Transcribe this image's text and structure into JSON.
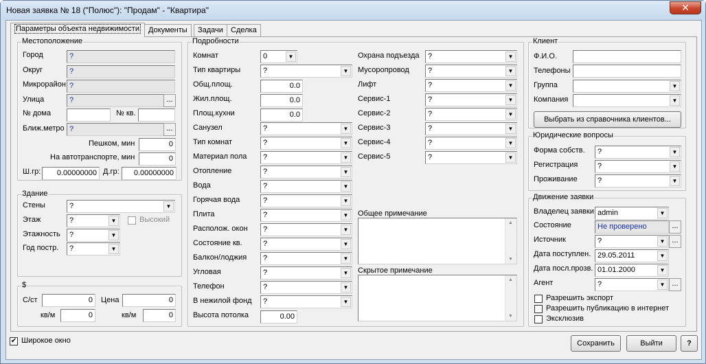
{
  "window": {
    "title": "Новая заявка № 18 (\"Полюс\"): \"Продам\" - \"Квартира\"",
    "close_glyph": "✕"
  },
  "tabs": [
    {
      "label": "Параметры объекта недвижимости"
    },
    {
      "label": "Документы"
    },
    {
      "label": "Задачи"
    },
    {
      "label": "Сделка"
    }
  ],
  "location": {
    "title": "Местоположение",
    "city": {
      "label": "Город",
      "value": "?"
    },
    "district": {
      "label": "Округ",
      "value": "?"
    },
    "microdistrict": {
      "label": "Микрорайон",
      "value": "?"
    },
    "street": {
      "label": "Улица",
      "value": "?"
    },
    "house": {
      "label": "№ дома",
      "value": ""
    },
    "apt": {
      "label": "№ кв.",
      "value": ""
    },
    "metro": {
      "label": "Ближ.метро",
      "value": "?"
    },
    "walk": {
      "label": "Пешком, мин",
      "value": "0"
    },
    "transport": {
      "label": "На автотранспорте, мин",
      "value": "0"
    },
    "lat": {
      "label": "Ш.гр:",
      "value": "0.00000000"
    },
    "lon": {
      "label": "Д.гр:",
      "value": "0.00000000"
    }
  },
  "building": {
    "title": "Здание",
    "walls": {
      "label": "Стены",
      "value": "?"
    },
    "floor": {
      "label": "Этаж",
      "value": "?"
    },
    "floors": {
      "label": "Этажность",
      "value": "?"
    },
    "year": {
      "label": "Год постр.",
      "value": "?"
    },
    "high": {
      "label": "Высокий",
      "checked": false
    }
  },
  "price": {
    "title": "$",
    "cost": {
      "label": "С/ст",
      "value": "0"
    },
    "price": {
      "label": "Цена",
      "value": "0"
    },
    "sqm1": {
      "label": "кв/м",
      "value": "0"
    },
    "sqm2": {
      "label": "кв/м",
      "value": "0"
    }
  },
  "details": {
    "title": "Подробности",
    "rooms": {
      "label": "Комнат",
      "value": "0"
    },
    "apt_type": {
      "label": "Тип квартиры",
      "value": "?"
    },
    "total_area": {
      "label": "Общ.площ.",
      "value": "0.0"
    },
    "living_area": {
      "label": "Жил.площ.",
      "value": "0.0"
    },
    "kitchen_area": {
      "label": "Площ.кухни",
      "value": "0.0"
    },
    "combo_rows": [
      {
        "label": "Санузел",
        "value": "?"
      },
      {
        "label": "Тип комнат",
        "value": "?"
      },
      {
        "label": "Материал пола",
        "value": "?"
      },
      {
        "label": "Отопление",
        "value": "?"
      },
      {
        "label": "Вода",
        "value": "?"
      },
      {
        "label": "Горячая вода",
        "value": "?"
      },
      {
        "label": "Плита",
        "value": "?"
      },
      {
        "label": "Располож. окон",
        "value": "?"
      },
      {
        "label": "Состояние кв.",
        "value": "?"
      },
      {
        "label": "Балкон/лоджия",
        "value": "?"
      },
      {
        "label": "Угловая",
        "value": "?"
      },
      {
        "label": "Телефон",
        "value": "?"
      },
      {
        "label": "В нежилой фонд",
        "value": "?"
      }
    ],
    "ceiling": {
      "label": "Высота потолка",
      "value": "0.00"
    },
    "right_rows": [
      {
        "label": "Охрана подъезда",
        "value": "?"
      },
      {
        "label": "Мусоропровод",
        "value": "?"
      },
      {
        "label": "Лифт",
        "value": "?"
      },
      {
        "label": "Сервис-1",
        "value": "?"
      },
      {
        "label": "Сервис-2",
        "value": "?"
      },
      {
        "label": "Сервис-3",
        "value": "?"
      },
      {
        "label": "Сервис-4",
        "value": "?"
      },
      {
        "label": "Сервис-5",
        "value": "?"
      }
    ],
    "general_note": {
      "label": "Общее примечание",
      "value": ""
    },
    "hidden_note": {
      "label": "Скрытое примечание",
      "value": ""
    }
  },
  "client": {
    "title": "Клиент",
    "name": {
      "label": "Ф.И.О.",
      "value": ""
    },
    "phones": {
      "label": "Телефоны",
      "value": ""
    },
    "group": {
      "label": "Группа",
      "value": ""
    },
    "company": {
      "label": "Компания",
      "value": ""
    },
    "pick_button": "Выбрать из справочника клиентов..."
  },
  "legal": {
    "title": "Юридические вопросы",
    "ownership": {
      "label": "Форма собств.",
      "value": "?"
    },
    "registration": {
      "label": "Регистрация",
      "value": "?"
    },
    "residence": {
      "label": "Проживание",
      "value": "?"
    }
  },
  "flow": {
    "title": "Движение заявки",
    "owner": {
      "label": "Владелец заявки",
      "value": "admin"
    },
    "state": {
      "label": "Состояние",
      "value": "Не проверено"
    },
    "source": {
      "label": "Источник",
      "value": "?"
    },
    "received": {
      "label": "Дата поступлен.",
      "value": "29.05.2011"
    },
    "checked": {
      "label": "Дата посл.прозв.",
      "value": "01.01.2000"
    },
    "agent": {
      "label": "Агент",
      "value": "?"
    },
    "export": {
      "label": "Разрешить экспорт",
      "checked": false
    },
    "publish": {
      "label": "Разрешить публикацию в интернет",
      "checked": false
    },
    "exclusive": {
      "label": "Эксклюзив",
      "checked": false
    }
  },
  "footer": {
    "wide_window": {
      "label": "Широкое окно",
      "checked": true
    },
    "save": "Сохранить",
    "exit": "Выйти",
    "help": "?"
  },
  "glyphs": {
    "dots": "...",
    "arrow": "▼",
    "check": "✔"
  }
}
